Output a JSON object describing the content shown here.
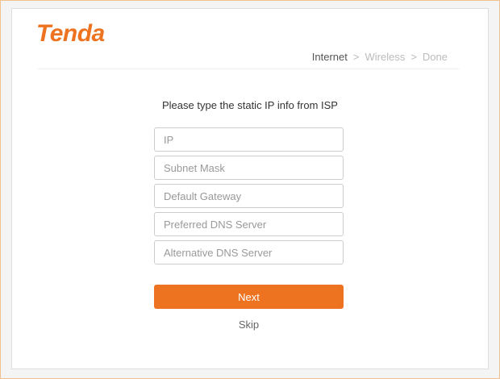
{
  "brand": {
    "logo_text": "Tenda",
    "accent_color": "#ee7320"
  },
  "steps": {
    "items": [
      "Internet",
      "Wireless",
      "Done"
    ],
    "separator": ">",
    "active_index": 0
  },
  "form": {
    "prompt": "Please type the static IP info from ISP",
    "fields": [
      {
        "value": "",
        "placeholder": "IP"
      },
      {
        "value": "",
        "placeholder": "Subnet Mask"
      },
      {
        "value": "",
        "placeholder": "Default Gateway"
      },
      {
        "value": "",
        "placeholder": "Preferred DNS Server"
      },
      {
        "value": "",
        "placeholder": "Alternative DNS Server"
      }
    ],
    "next_label": "Next",
    "skip_label": "Skip"
  }
}
